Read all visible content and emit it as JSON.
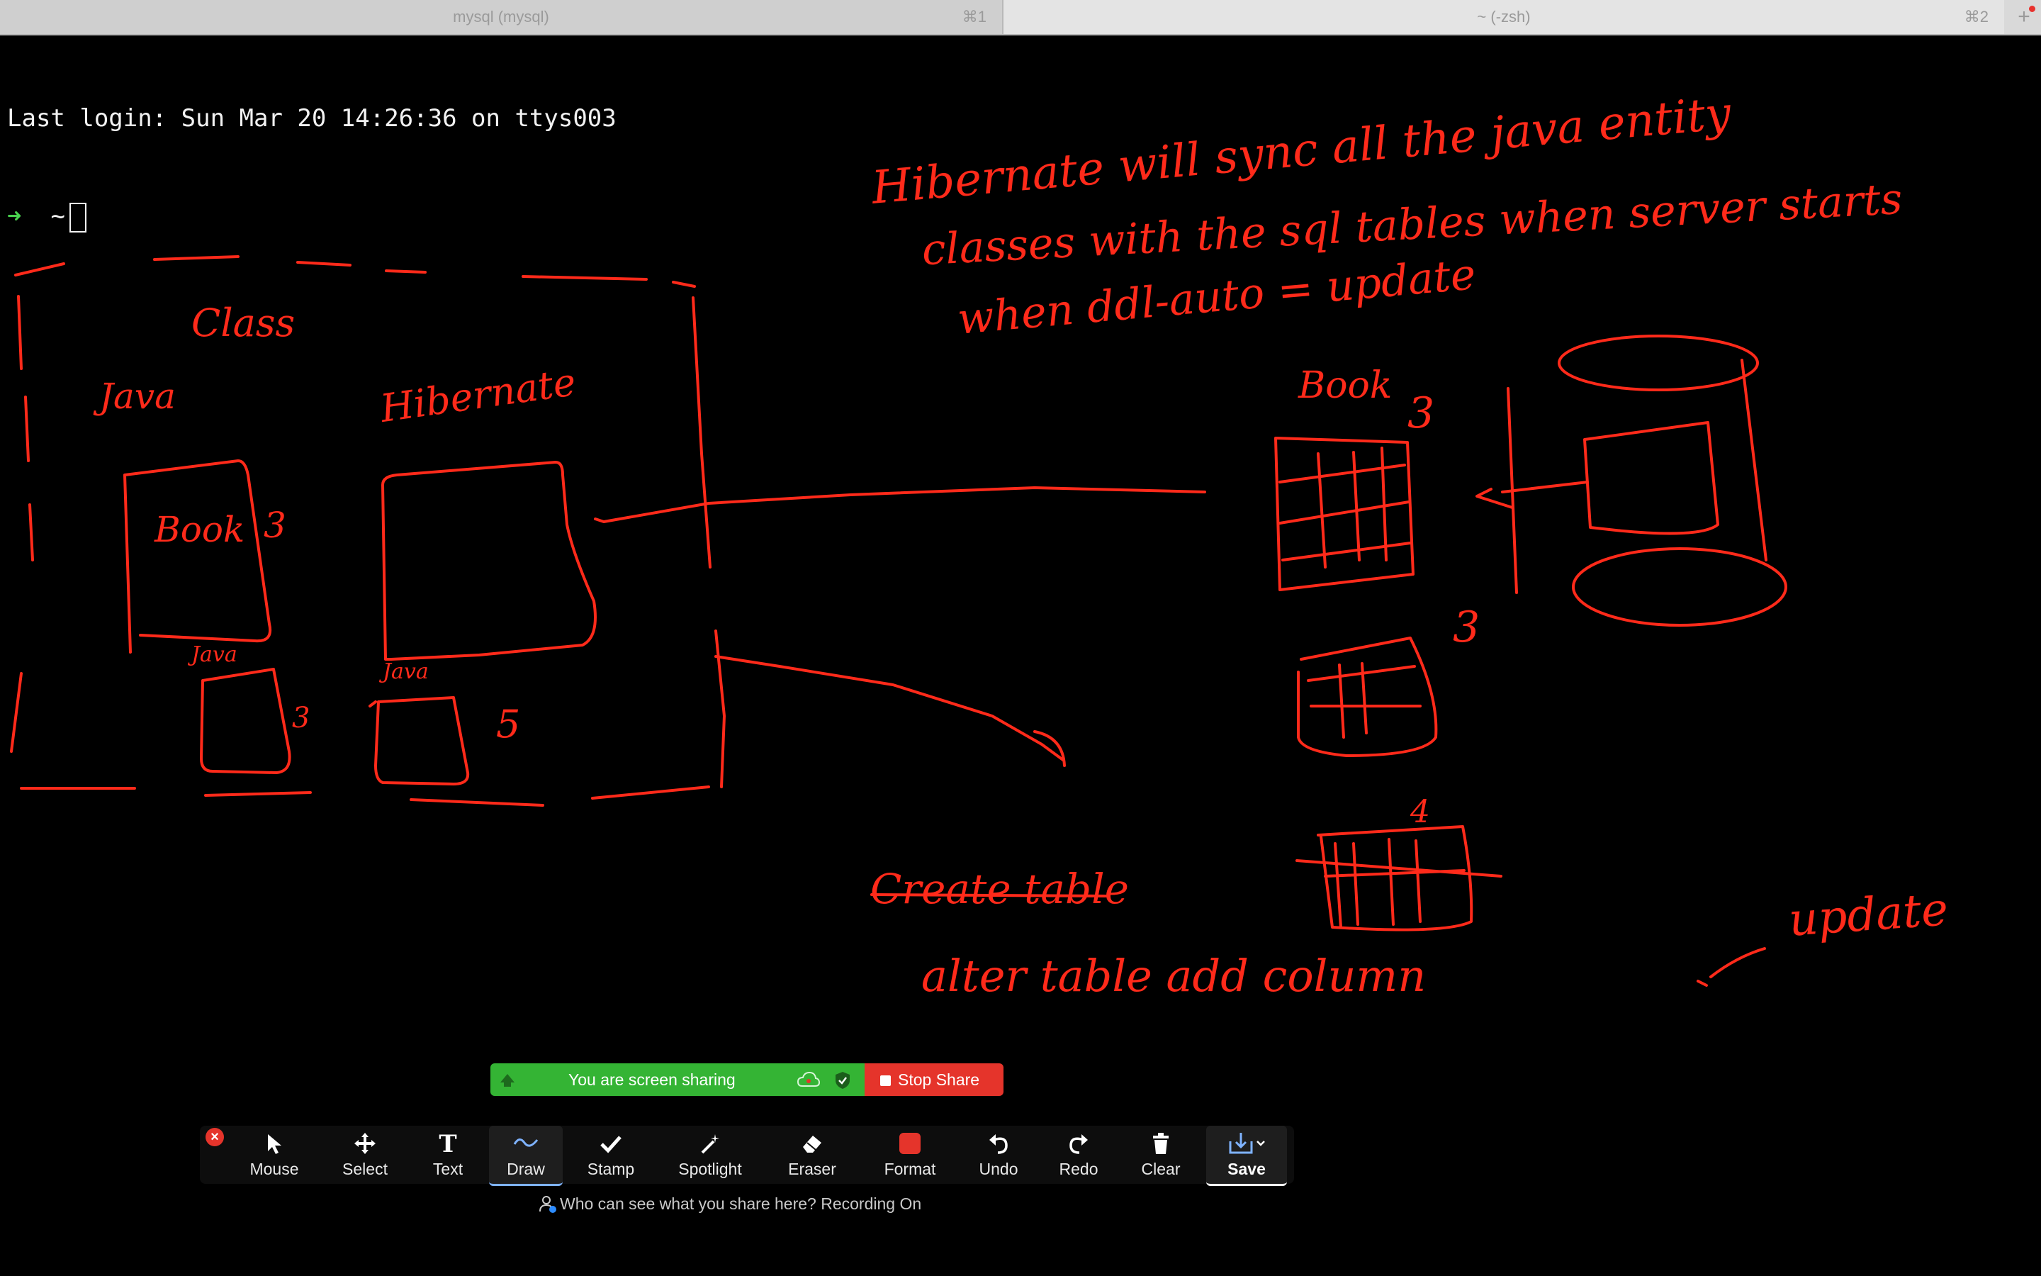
{
  "terminal": {
    "tabs": [
      {
        "title": "mysql (mysql)",
        "shortcut": "⌘1"
      },
      {
        "title": "~ (-zsh)",
        "shortcut": "⌘2"
      }
    ],
    "new_tab_label": "+",
    "last_login": "Last login: Sun Mar 20 14:26:36 on ttys003",
    "prompt_arrow": "➜",
    "prompt_dir": "~"
  },
  "whiteboard": {
    "ink_color": "#ff2a1a",
    "notes": {
      "top_line1": "Hibernate will sync all the java entity",
      "top_line2": "classes with the sql tables when server starts",
      "top_line3": "when ddl-auto = update",
      "class_label": "Class",
      "java_label": "Java",
      "hibernate_label": "Hibernate",
      "book_label": "Book",
      "book_db_label": "Book",
      "num_3_a": "3",
      "num_3_b": "3",
      "num_3_c": "3",
      "num_3_d": "3",
      "num_5": "5",
      "num_4": "4",
      "java_small": "Java",
      "java_small2": "Java",
      "create_table": "Create table",
      "alter_table": "alter table add column",
      "update": "update"
    }
  },
  "share_banner": {
    "status_text": "You are screen sharing",
    "stop_label": "Stop Share",
    "green": "#34b434",
    "red": "#e5342b"
  },
  "toolbar": {
    "tools": [
      {
        "label": "Mouse",
        "icon": "mouse-pointer-icon"
      },
      {
        "label": "Select",
        "icon": "move-arrows-icon"
      },
      {
        "label": "Text",
        "icon": "text-t-icon"
      },
      {
        "label": "Draw",
        "icon": "squiggle-icon",
        "active": true
      },
      {
        "label": "Stamp",
        "icon": "checkmark-icon"
      },
      {
        "label": "Spotlight",
        "icon": "magic-wand-icon"
      },
      {
        "label": "Eraser",
        "icon": "eraser-icon"
      },
      {
        "label": "Format",
        "icon": "color-swatch-icon"
      },
      {
        "label": "Undo",
        "icon": "undo-icon"
      },
      {
        "label": "Redo",
        "icon": "redo-icon"
      },
      {
        "label": "Clear",
        "icon": "trash-icon"
      },
      {
        "label": "Save",
        "icon": "save-download-icon"
      }
    ],
    "format_color": "#e5342b"
  },
  "footer": {
    "who_can_see": "Who can see what you share here? Recording On"
  }
}
